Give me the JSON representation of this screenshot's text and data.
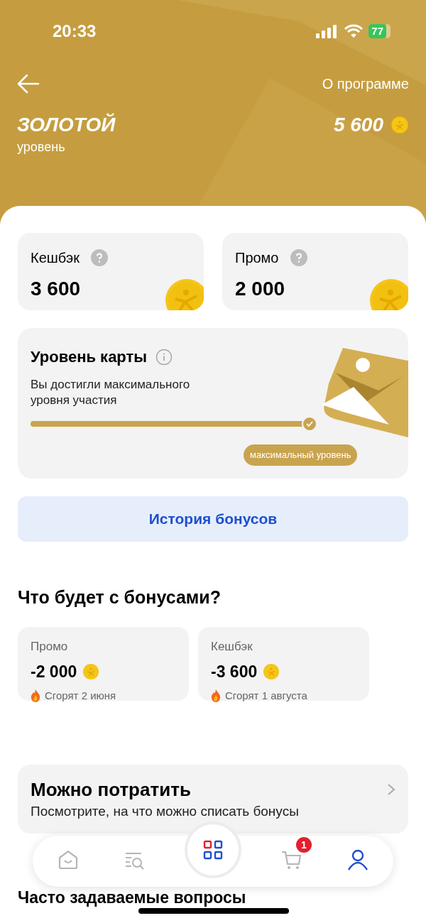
{
  "status_bar": {
    "time": "20:33",
    "battery": "77"
  },
  "header": {
    "about_link": "О программе",
    "level_name": "ЗОЛОТОЙ",
    "level_caption": "уровень",
    "balance": "5 600"
  },
  "balances": [
    {
      "label": "Кешбэк",
      "amount": "3 600"
    },
    {
      "label": "Промо",
      "amount": "2 000"
    }
  ],
  "card_level": {
    "title": "Уровень карты",
    "description": "Вы достигли максимального уровня участия",
    "level": 1,
    "badge": "максимальный уровень"
  },
  "history_button": "История бонусов",
  "expiry": {
    "heading": "Что будет с бонусами?",
    "items": [
      {
        "label": "Промо",
        "amount": "-2 000",
        "note": "Сгорят 2 июня"
      },
      {
        "label": "Кешбэк",
        "amount": "-3 600",
        "note": "Сгорят 1 августа"
      }
    ]
  },
  "spend": {
    "title": "Можно потратить",
    "subtitle": "Посмотрите, на что можно списать бонусы"
  },
  "faq_heading": "Часто задаваемые вопросы",
  "nav": [
    {
      "kind": "home",
      "selected": false
    },
    {
      "kind": "search",
      "selected": false
    },
    {
      "kind": "catalog",
      "selected": false
    },
    {
      "kind": "cart",
      "selected": false,
      "badge": "1"
    },
    {
      "kind": "profile",
      "selected": true
    }
  ]
}
